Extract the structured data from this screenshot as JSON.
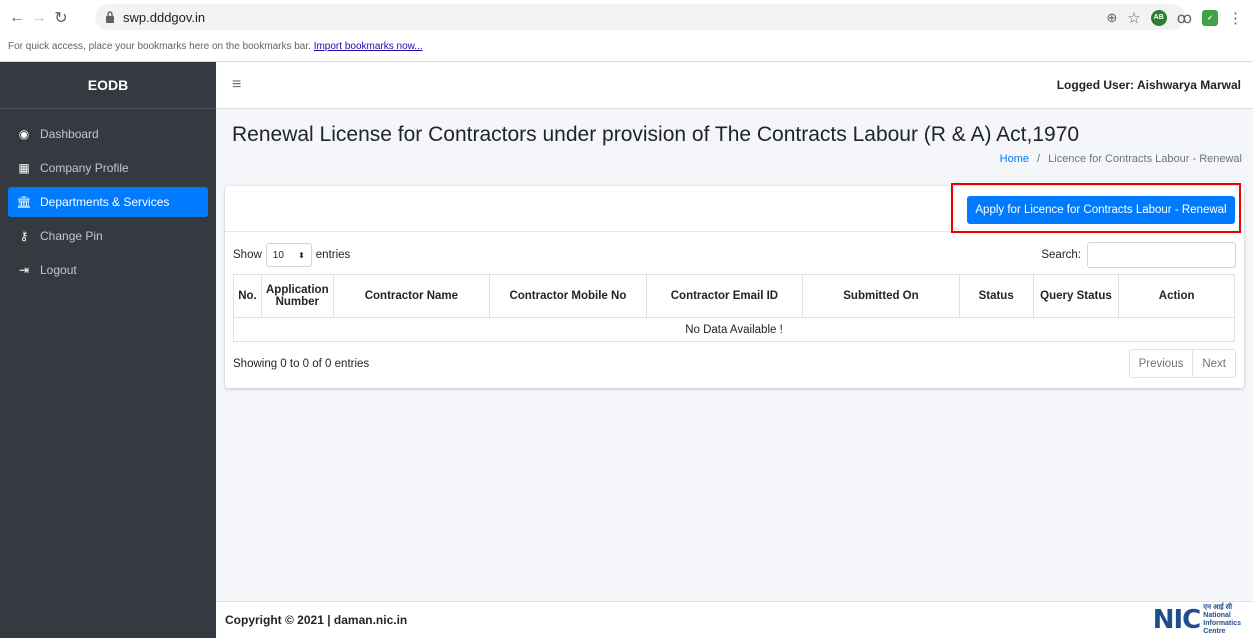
{
  "browser": {
    "url": "swp.dddgov.in",
    "bookmarks_hint": "For quick access, place your bookmarks here on the bookmarks bar.",
    "import_link": "Import bookmarks now..."
  },
  "sidebar": {
    "brand": "EODB",
    "items": [
      {
        "label": "Dashboard",
        "icon": "dashboard-icon"
      },
      {
        "label": "Company Profile",
        "icon": "building-icon"
      },
      {
        "label": "Departments & Services",
        "icon": "bank-icon",
        "active": true
      },
      {
        "label": "Change Pin",
        "icon": "key-icon"
      },
      {
        "label": "Logout",
        "icon": "logout-icon"
      }
    ]
  },
  "topbar": {
    "logged_user": "Logged User: Aishwarya Marwal"
  },
  "main": {
    "title": "Renewal License for Contractors under provision of The Contracts Labour (R & A) Act,1970",
    "breadcrumb": {
      "home": "Home",
      "separator": "/",
      "current": "Licence for Contracts Labour - Renewal"
    },
    "apply_button": "Apply for Licence for Contracts Labour - Renewal",
    "table_controls": {
      "show_label": "Show",
      "entries_value": "10",
      "entries_label": "entries",
      "search_label": "Search:"
    },
    "table": {
      "columns": [
        "No.",
        "Application Number",
        "Contractor Name",
        "Contractor Mobile No",
        "Contractor Email ID",
        "Submitted On",
        "Status",
        "Query Status",
        "Action"
      ],
      "empty_message": "No Data Available !"
    },
    "info": "Showing 0 to 0 of 0 entries",
    "pagination": {
      "previous": "Previous",
      "next": "Next"
    }
  },
  "footer": {
    "copyright": "Copyright © 2021 | daman.nic.in",
    "logo_mark": "NIC",
    "logo_text_hindi": "एन आई सी",
    "logo_text_line1": "National",
    "logo_text_line2": "Informatics",
    "logo_text_line3": "Centre"
  },
  "colors": {
    "sidebar_bg": "#343a40",
    "primary": "#007bff",
    "content_bg": "#f4f6f9",
    "highlight": "#ee0000"
  }
}
